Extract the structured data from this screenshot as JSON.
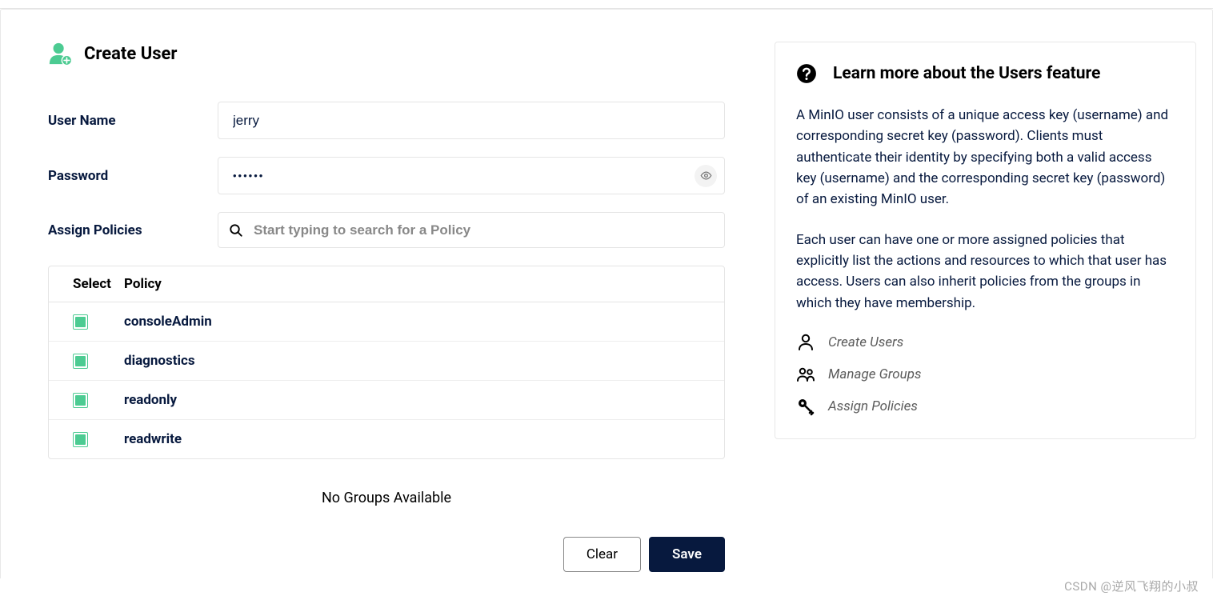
{
  "header": {
    "title": "Create User"
  },
  "form": {
    "username_label": "User Name",
    "username_value": "jerry",
    "password_label": "Password",
    "password_value": "••••••",
    "assign_label": "Assign Policies",
    "search_placeholder": "Start typing to search for a Policy"
  },
  "table": {
    "col_select": "Select",
    "col_policy": "Policy",
    "rows": [
      {
        "name": "consoleAdmin"
      },
      {
        "name": "diagnostics"
      },
      {
        "name": "readonly"
      },
      {
        "name": "readwrite"
      }
    ]
  },
  "groups_msg": "No Groups Available",
  "buttons": {
    "clear": "Clear",
    "save": "Save"
  },
  "sidebar": {
    "title": "Learn more about the Users feature",
    "para1": "A MinIO user consists of a unique access key (username) and corresponding secret key (password). Clients must authenticate their identity by specifying both a valid access key (username) and the corresponding secret key (password) of an existing MinIO user.",
    "para2": "Each user can have one or more assigned policies that explicitly list the actions and resources to which that user has access. Users can also inherit policies from the groups in which they have membership.",
    "links": {
      "create": "Create Users",
      "manage": "Manage Groups",
      "assign": "Assign Policies"
    }
  },
  "watermark": "CSDN @逆风飞翔的小叔"
}
